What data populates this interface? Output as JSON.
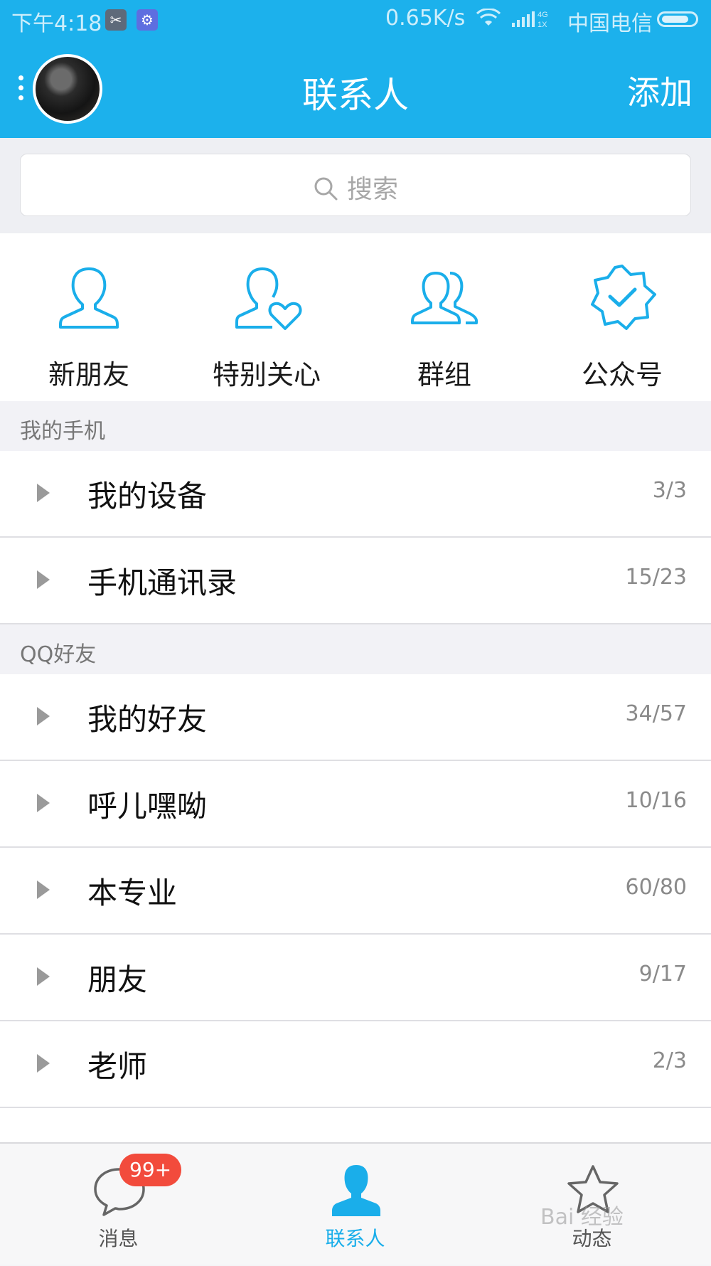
{
  "status_bar": {
    "time": "下午4:18",
    "speed": "0.65K/s",
    "network": "4G 1X",
    "carrier": "中国电信",
    "battery_level": 0.85
  },
  "header": {
    "title": "联系人",
    "add_label": "添加"
  },
  "search": {
    "placeholder": "搜索"
  },
  "quick_actions": [
    {
      "label": "新朋友",
      "icon": "new-friend-icon"
    },
    {
      "label": "特别关心",
      "icon": "special-care-icon"
    },
    {
      "label": "群组",
      "icon": "group-icon"
    },
    {
      "label": "公众号",
      "icon": "official-account-icon"
    }
  ],
  "sections": [
    {
      "title": "我的手机",
      "rows": [
        {
          "name": "我的设备",
          "count": "3/3"
        },
        {
          "name": "手机通讯录",
          "count": "15/23"
        }
      ]
    },
    {
      "title": "QQ好友",
      "rows": [
        {
          "name": "我的好友",
          "count": "34/57"
        },
        {
          "name": "呼儿嘿呦",
          "count": "10/16"
        },
        {
          "name": "本专业",
          "count": "60/80"
        },
        {
          "name": "朋友",
          "count": "9/17"
        },
        {
          "name": "老师",
          "count": "2/3"
        }
      ]
    }
  ],
  "tabs": [
    {
      "label": "消息",
      "icon": "message-icon",
      "badge": "99+",
      "active": false
    },
    {
      "label": "联系人",
      "icon": "contacts-icon",
      "active": true
    },
    {
      "label": "动态",
      "icon": "star-icon",
      "active": false
    }
  ],
  "watermark": "Bai 经验",
  "colors": {
    "primary": "#1cb1ec",
    "badge": "#f24b3c"
  }
}
